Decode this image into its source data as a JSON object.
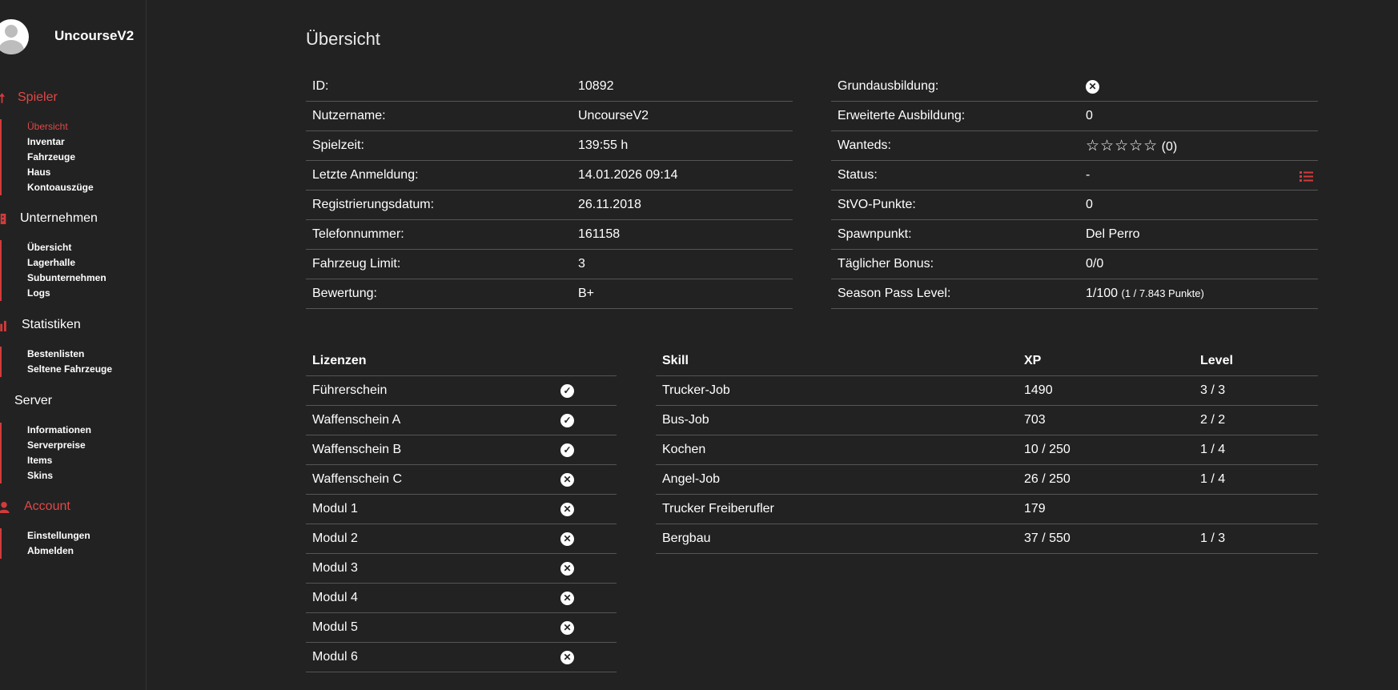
{
  "user": {
    "name": "UncourseV2"
  },
  "sidebar": {
    "sections": [
      {
        "title": "Spieler",
        "icon": "arrow-up-icon",
        "items": [
          "Übersicht",
          "Inventar",
          "Fahrzeuge",
          "Haus",
          "Kontoauszüge"
        ]
      },
      {
        "title": "Unternehmen",
        "icon": "building-icon",
        "items": [
          "Übersicht",
          "Lagerhalle",
          "Subunternehmen",
          "Logs"
        ]
      },
      {
        "title": "Statistiken",
        "icon": "bar-chart-icon",
        "items": [
          "Bestenlisten",
          "Seltene Fahrzeuge"
        ]
      },
      {
        "title": "Server",
        "icon": "",
        "items": [
          "Informationen",
          "Serverpreise",
          "Items",
          "Skins"
        ]
      },
      {
        "title": "Account",
        "icon": "user-icon",
        "items": [
          "Einstellungen",
          "Abmelden"
        ]
      }
    ]
  },
  "page": {
    "title": "Übersicht"
  },
  "info_left": [
    {
      "label": "ID:",
      "value": "10892"
    },
    {
      "label": "Nutzername:",
      "value": "UncourseV2"
    },
    {
      "label": "Spielzeit:",
      "value": "139:55 h"
    },
    {
      "label": "Letzte Anmeldung:",
      "value": "14.01.2026 09:14"
    },
    {
      "label": "Registrierungsdatum:",
      "value": "26.11.2018"
    },
    {
      "label": "Telefonnummer:",
      "value": "161158"
    },
    {
      "label": "Fahrzeug Limit:",
      "value": "3"
    },
    {
      "label": "Bewertung:",
      "value": "B+"
    }
  ],
  "info_right": {
    "grundausbildung": {
      "label": "Grundausbildung:",
      "icon": "x-circle-icon"
    },
    "erweiterte": {
      "label": "Erweiterte Ausbildung:",
      "value": "0"
    },
    "wanteds": {
      "label": "Wanteds:",
      "stars": "☆☆☆☆☆",
      "count": "(0)",
      "stars_filled": 0,
      "stars_total": 5
    },
    "status": {
      "label": "Status:",
      "value": "-",
      "icon": "list-icon"
    },
    "stvo": {
      "label": "StVO-Punkte:",
      "value": "0"
    },
    "spawn": {
      "label": "Spawnpunkt:",
      "value": "Del Perro"
    },
    "bonus": {
      "label": "Täglicher Bonus:",
      "value": "0/0"
    },
    "season": {
      "label": "Season Pass Level:",
      "value": "1/100",
      "detail": "(1 / 7.843 Punkte)"
    }
  },
  "licenses": {
    "header": "Lizenzen",
    "rows": [
      {
        "name": "Führerschein",
        "has": true
      },
      {
        "name": "Waffenschein A",
        "has": true
      },
      {
        "name": "Waffenschein B",
        "has": true
      },
      {
        "name": "Waffenschein C",
        "has": false
      },
      {
        "name": "Modul 1",
        "has": false
      },
      {
        "name": "Modul 2",
        "has": false
      },
      {
        "name": "Modul 3",
        "has": false
      },
      {
        "name": "Modul 4",
        "has": false
      },
      {
        "name": "Modul 5",
        "has": false
      },
      {
        "name": "Modul 6",
        "has": false
      }
    ]
  },
  "skills": {
    "headers": {
      "skill": "Skill",
      "xp": "XP",
      "level": "Level"
    },
    "rows": [
      {
        "skill": "Trucker-Job",
        "xp": "1490",
        "level": "3 / 3"
      },
      {
        "skill": "Bus-Job",
        "xp": "703",
        "level": "2 / 2"
      },
      {
        "skill": "Kochen",
        "xp": "10 / 250",
        "level": "1 / 4"
      },
      {
        "skill": "Angel-Job",
        "xp": "26 / 250",
        "level": "1 / 4"
      },
      {
        "skill": "Trucker Freiberufler",
        "xp": "179",
        "level": ""
      },
      {
        "skill": "Bergbau",
        "xp": "37 / 550",
        "level": "1 / 3"
      }
    ]
  },
  "colors": {
    "accent": "#d23b3b",
    "background": "#222222",
    "text": "#ffffff",
    "border": "#555555"
  }
}
